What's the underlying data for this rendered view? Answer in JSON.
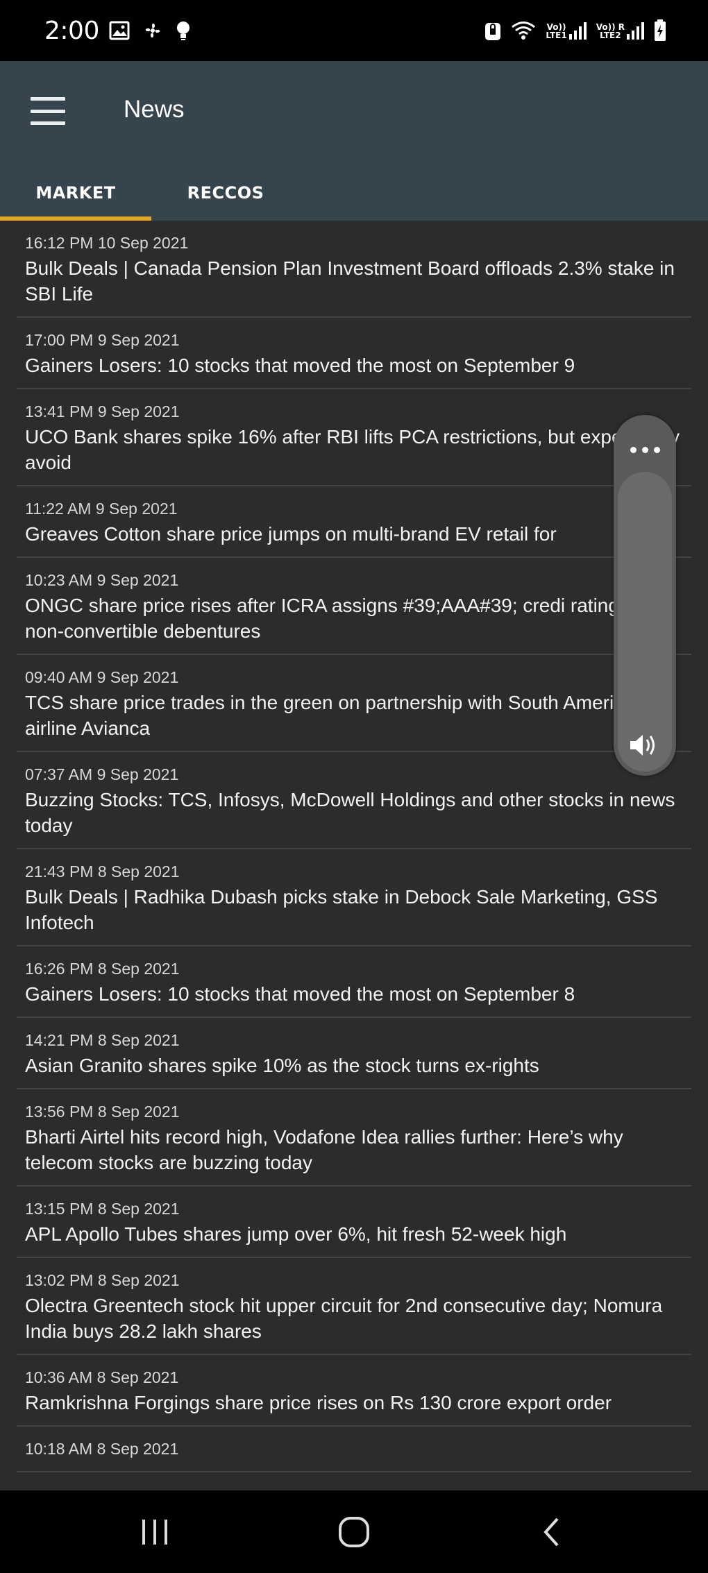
{
  "status_bar": {
    "time": "2:00",
    "left_icons": [
      "image-icon",
      "fan-icon",
      "bulb-icon"
    ],
    "right_icons": [
      "lock-icon",
      "wifi-icon",
      "signal-icon",
      "signal-icon",
      "battery-icon"
    ],
    "sim1_label_top": "Vo))",
    "sim1_label_bottom": "LTE1",
    "sim2_label_top": "Vo))",
    "sim2_label_bottom": "LTE2",
    "sim2_roaming": "R"
  },
  "app_bar": {
    "title": "News",
    "menu_icon": "hamburger-menu-icon",
    "color": "#36454d"
  },
  "tabs": [
    {
      "label": "MARKET",
      "selected": true
    },
    {
      "label": "RECCOS",
      "selected": false
    }
  ],
  "accent_color": "#e0a62a",
  "news": [
    {
      "timestamp": "16:12 PM 10 Sep 2021",
      "headline": "Bulk Deals | Canada Pension Plan Investment Board offloads 2.3% stake in SBI Life"
    },
    {
      "timestamp": "17:00 PM 9 Sep 2021",
      "headline": "Gainers  Losers: 10 stocks that moved the most on September 9"
    },
    {
      "timestamp": "13:41 PM 9 Sep 2021",
      "headline": "UCO Bank shares spike 16% after RBI lifts PCA restrictions, but experts say avoid"
    },
    {
      "timestamp": "11:22 AM 9 Sep 2021",
      "headline": "Greaves Cotton share price jumps on multi-brand EV retail for"
    },
    {
      "timestamp": "10:23 AM 9 Sep 2021",
      "headline": "ONGC share price rises after ICRA assigns #39;AAA#39; credi rating to non-convertible debentures"
    },
    {
      "timestamp": "09:40 AM 9 Sep 2021",
      "headline": "TCS share price trades in the green on partnership with South American airline Avianca"
    },
    {
      "timestamp": "07:37 AM 9 Sep 2021",
      "headline": "Buzzing Stocks: TCS, Infosys, McDowell Holdings and other stocks in news today"
    },
    {
      "timestamp": "21:43 PM 8 Sep 2021",
      "headline": "Bulk Deals | Radhika Dubash picks stake in Debock Sale Marketing, GSS Infotech"
    },
    {
      "timestamp": "16:26 PM 8 Sep 2021",
      "headline": "Gainers  Losers: 10 stocks that moved the most on September 8"
    },
    {
      "timestamp": "14:21 PM 8 Sep 2021",
      "headline": "Asian Granito shares spike 10% as the stock turns ex-rights"
    },
    {
      "timestamp": "13:56 PM 8 Sep 2021",
      "headline": "Bharti Airtel hits record high, Vodafone Idea rallies further: Here’s why telecom stocks are buzzing today"
    },
    {
      "timestamp": "13:15 PM 8 Sep 2021",
      "headline": "APL Apollo Tubes shares jump over 6%, hit fresh 52-week high"
    },
    {
      "timestamp": "13:02 PM 8 Sep 2021",
      "headline": "Olectra Greentech stock hit upper circuit for 2nd consecutive day; Nomura India buys 28.2 lakh shares"
    },
    {
      "timestamp": "10:36 AM 8 Sep 2021",
      "headline": "Ramkrishna Forgings share price rises on Rs 130 crore export order"
    },
    {
      "timestamp": "10:18 AM 8 Sep 2021",
      "headline": ""
    }
  ],
  "volume_panel": {
    "more_icon": "more-options-icon",
    "speaker_icon": "speaker-icon"
  },
  "nav_bar": {
    "buttons": [
      "recent-apps-icon",
      "home-icon",
      "back-icon"
    ]
  }
}
